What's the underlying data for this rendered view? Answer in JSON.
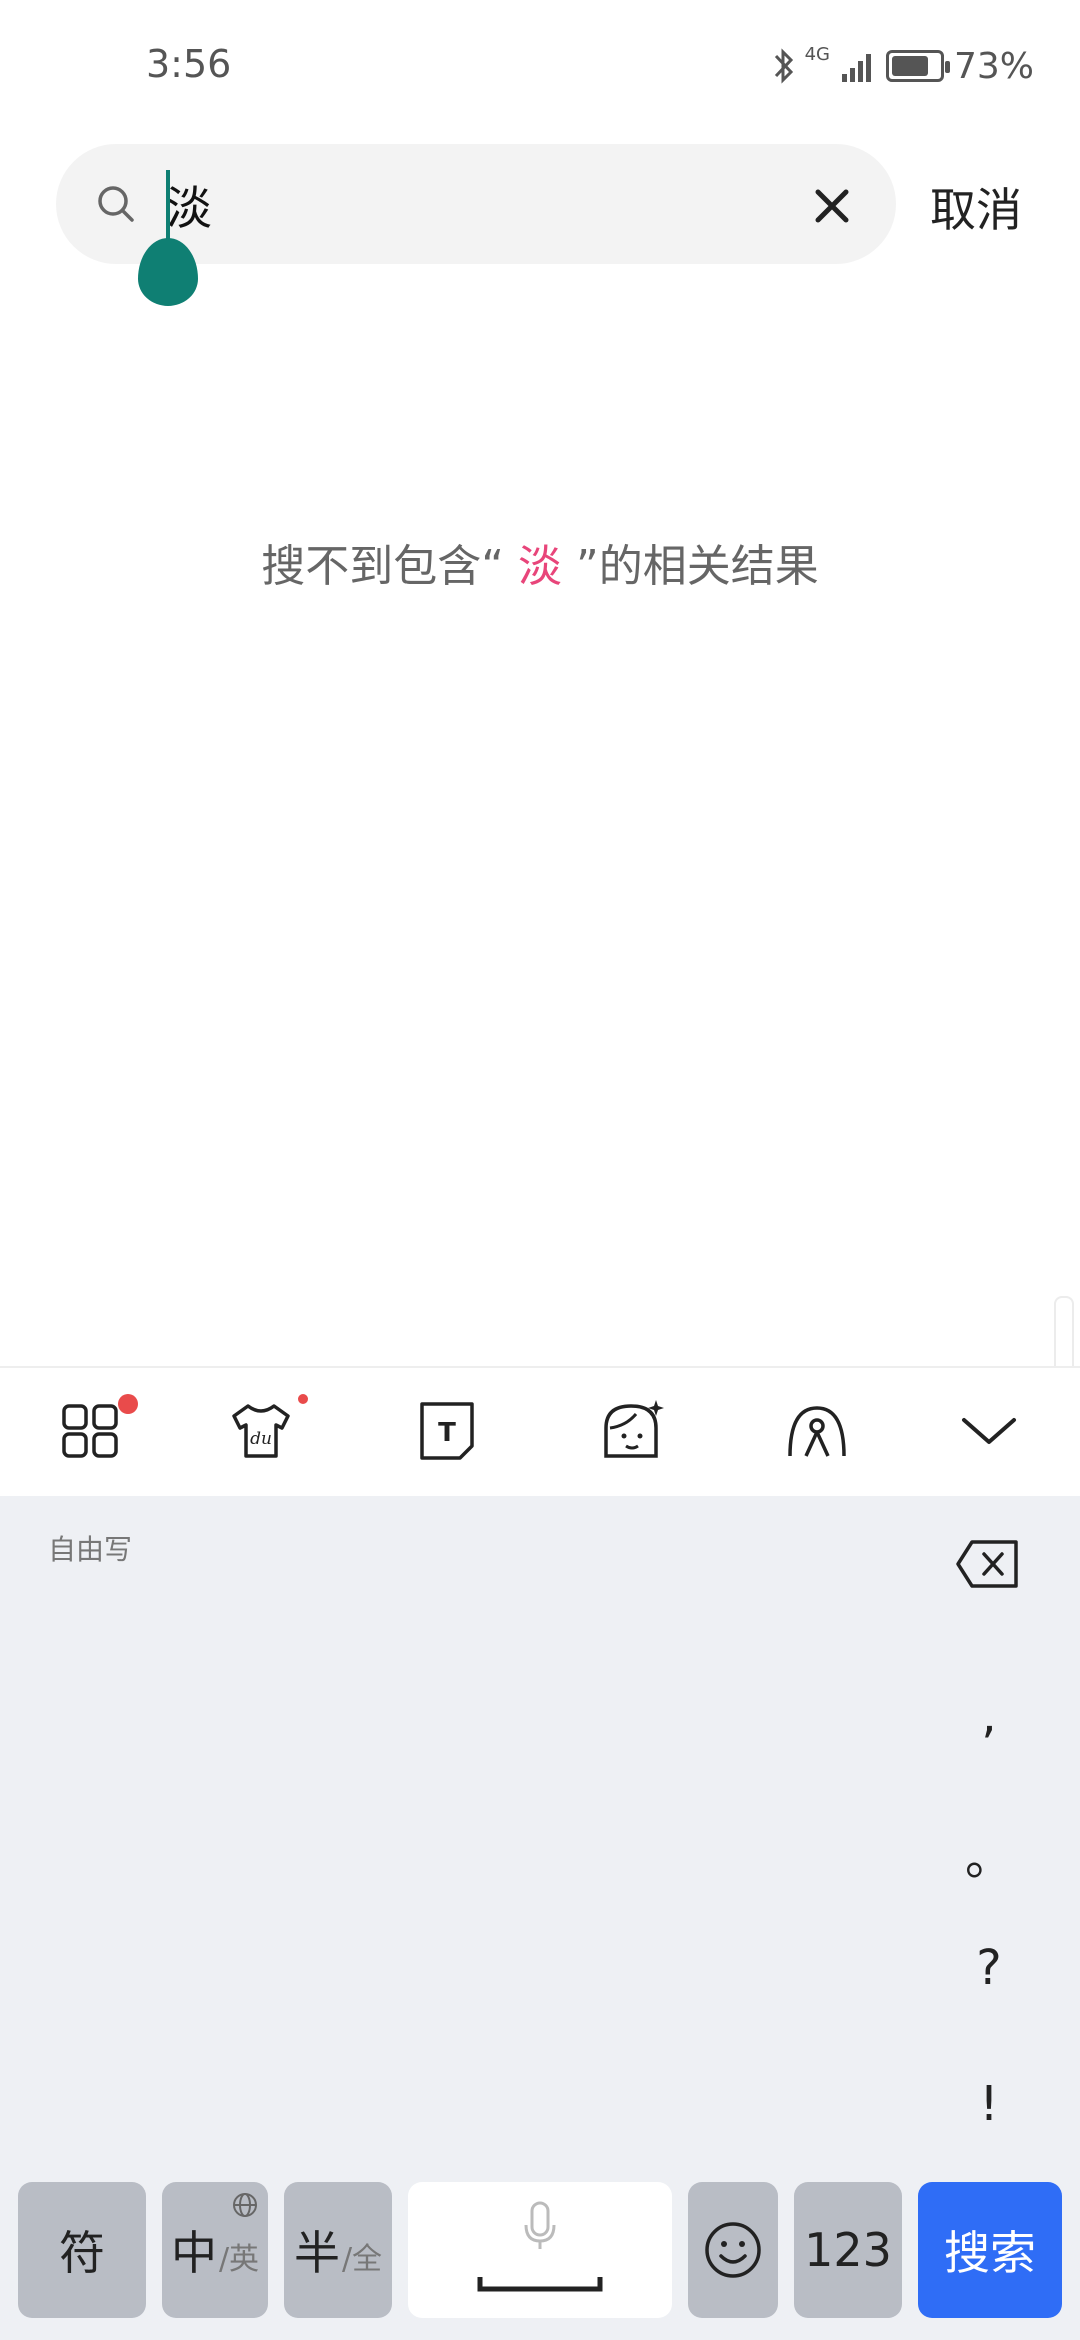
{
  "status_bar": {
    "time": "3:56",
    "network": "4G",
    "battery": "73%",
    "battery_level": 0.73,
    "icons": [
      "bluetooth-icon",
      "signal-icon",
      "battery-icon"
    ]
  },
  "search": {
    "query": "淡",
    "cancel_label": "取消",
    "icons": [
      "search-icon",
      "clear-icon"
    ]
  },
  "empty_state": {
    "prefix": "搜不到包含“",
    "query": "淡",
    "suffix": "”的相关结果",
    "accent_color": "#e8457a"
  },
  "keyboard": {
    "toolbar_icons": [
      "apps-grid-icon",
      "skin-shirt-icon",
      "text-tool-icon",
      "sticker-face-icon",
      "handwriting-icon",
      "collapse-chevron-icon"
    ],
    "handwrite_label": "自由写",
    "punctuation": [
      ",",
      "。",
      "?",
      "!"
    ],
    "keys": {
      "symbols": "符",
      "lang_main": "中",
      "lang_sub": "/英",
      "width_main": "半",
      "width_sub": "/全",
      "numbers": "123",
      "search": "搜索"
    },
    "colors": {
      "accent_blue": "#2f6df6",
      "cursor_teal": "#0f7f73",
      "notification_red": "#e94b4b"
    }
  }
}
